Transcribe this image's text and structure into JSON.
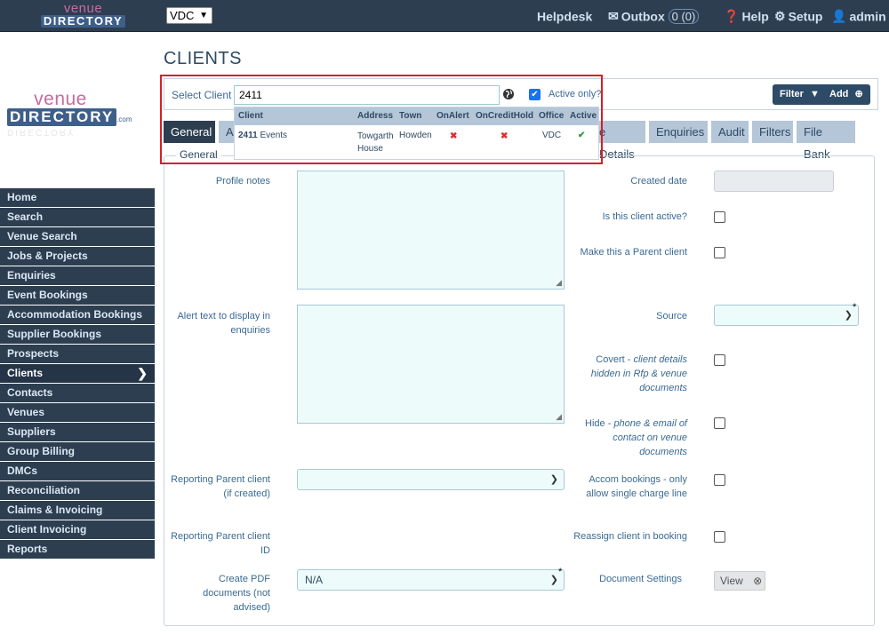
{
  "topbar": {
    "logo_top": "venue",
    "logo_bottom": "DIRECTORY",
    "office_selected": "VDC",
    "helpdesk": "Helpdesk",
    "outbox": "Outbox",
    "outbox_count": "0 (0)",
    "help": "Help",
    "setup": "Setup",
    "user": "admin"
  },
  "logo": {
    "top": "venue",
    "bottom": "DIRECTORY",
    "suffix": ".com"
  },
  "sidebar": {
    "items": [
      {
        "label": "Home"
      },
      {
        "label": "Search"
      },
      {
        "label": "Venue Search"
      },
      {
        "label": "Jobs & Projects"
      },
      {
        "label": "Enquiries"
      },
      {
        "label": "Event Bookings"
      },
      {
        "label": "Accommodation Bookings"
      },
      {
        "label": "Supplier Bookings"
      },
      {
        "label": "Prospects"
      },
      {
        "label": "Clients"
      },
      {
        "label": "Contacts"
      },
      {
        "label": "Venues"
      },
      {
        "label": "Suppliers"
      },
      {
        "label": "Group Billing"
      },
      {
        "label": "DMCs"
      },
      {
        "label": "Reconciliation"
      },
      {
        "label": "Claims & Invoicing"
      },
      {
        "label": "Client Invoicing"
      },
      {
        "label": "Reports"
      }
    ],
    "active_index": 9
  },
  "page": {
    "title": "CLIENTS"
  },
  "client_bar": {
    "label": "Select Client",
    "search_value": "2411",
    "active_only_label": "Active only?",
    "active_only_checked": true,
    "filter_label": "Filter",
    "add_label": "Add"
  },
  "dropdown": {
    "columns": [
      "Client",
      "Address",
      "Town",
      "OnAlert",
      "OnCreditHold",
      "Office",
      "Active"
    ],
    "rows": [
      {
        "client_number": "2411",
        "client_name": "Events",
        "address_line1": "Towgarth",
        "address_line2": "House",
        "town": "Howden",
        "on_alert": "✖",
        "on_credit_hold": "✖",
        "office": "VDC",
        "active": "✔"
      }
    ]
  },
  "tabs": {
    "general": "General",
    "partial_left": "A",
    "partial_details": "e Details",
    "enquiries": "Enquiries",
    "audit": "Audit",
    "filters": "Filters",
    "file_bank": "File Bank"
  },
  "form": {
    "legend": "General",
    "profile_notes": "Profile notes",
    "alert_text": "Alert text to display in enquiries",
    "reporting_parent": "Reporting Parent client (if created)",
    "reporting_parent_id": "Reporting Parent client ID",
    "create_pdf": "Create PDF documents (not advised)",
    "create_pdf_value": "N/A",
    "created_date": "Created date",
    "is_active": "Is this client active?",
    "make_parent": "Make this a Parent client",
    "source": "Source",
    "covert_prefix": "Covert - ",
    "covert_detail": "client details hidden in Rfp & venue documents",
    "hide_prefix": "Hide - ",
    "hide_detail": "phone & email of contact on venue documents",
    "accom": "Accom bookings - only allow single charge line",
    "reassign": "Reassign client in booking",
    "document_settings": "Document Settings",
    "view_label": "View"
  }
}
